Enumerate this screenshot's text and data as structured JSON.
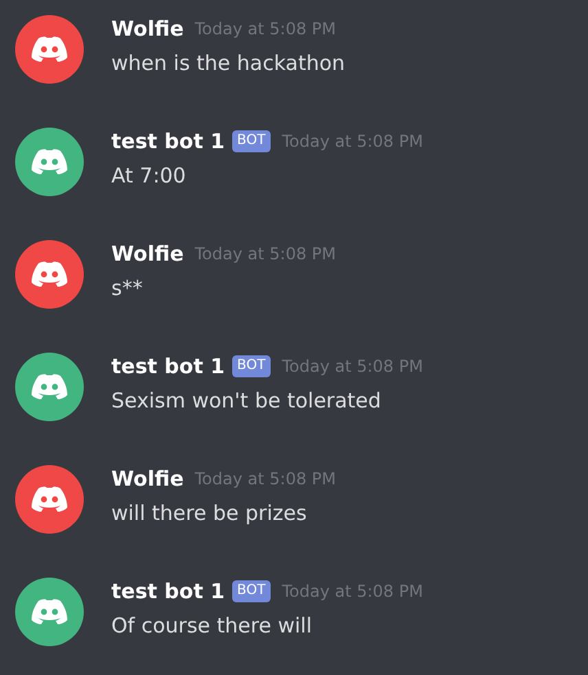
{
  "messages": [
    {
      "author": "Wolfie",
      "color": "#f04747",
      "timestamp": "Today at 5:08 PM",
      "content": "when is the hackathon"
    },
    {
      "author": "test bot 1",
      "color": "#43b581",
      "badge": "BOT",
      "timestamp": "Today at 5:08 PM",
      "content": "At 7:00"
    },
    {
      "author": "Wolfie",
      "color": "#f04747",
      "timestamp": "Today at 5:08 PM",
      "content": "s**"
    },
    {
      "author": "test bot 1",
      "color": "#43b581",
      "badge": "BOT",
      "timestamp": "Today at 5:08 PM",
      "content": "Sexism won't be tolerated"
    },
    {
      "author": "Wolfie",
      "color": "#f04747",
      "timestamp": "Today at 5:08 PM",
      "content": "will there be prizes"
    },
    {
      "author": "test bot 1",
      "color": "#43b581",
      "badge": "BOT",
      "timestamp": "Today at 5:08 PM",
      "content": "Of course there will"
    }
  ]
}
